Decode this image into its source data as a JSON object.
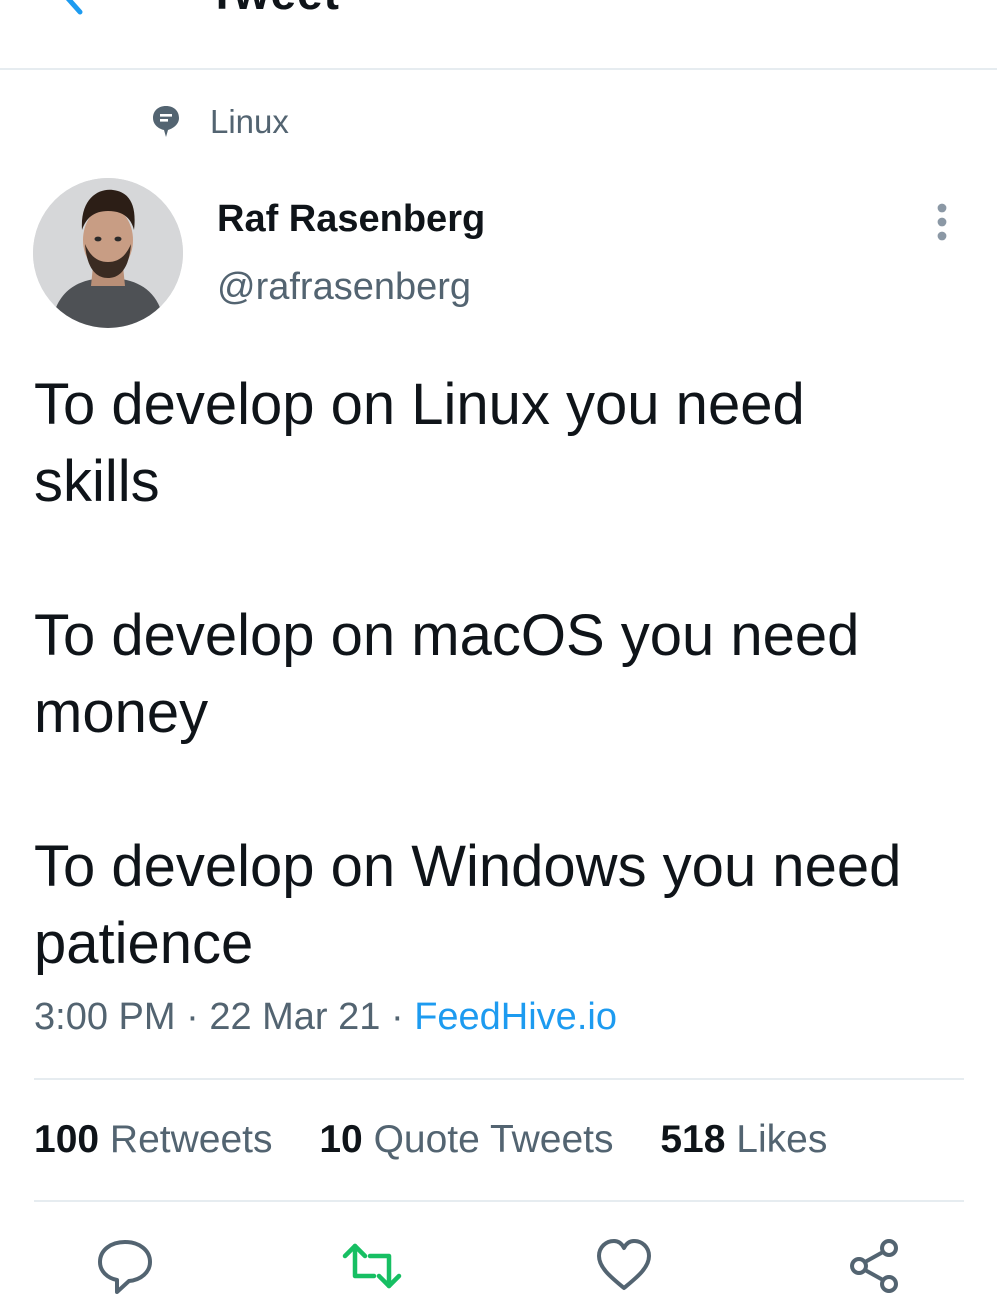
{
  "header": {
    "title": "Tweet"
  },
  "topic": {
    "label": "Linux"
  },
  "author": {
    "name": "Raf Rasenberg",
    "handle": "@rafrasenberg"
  },
  "tweet": {
    "paragraphs": [
      {
        "line1": "To develop on Linux you need",
        "line2": "skills"
      },
      {
        "line1": "To develop on macOS you need",
        "line2": "money"
      },
      {
        "line1": "To develop on Windows you need",
        "line2": "patience"
      }
    ],
    "time": "3:00 PM",
    "separator": "·",
    "date": "22 Mar 21",
    "source": "FeedHive.io"
  },
  "stats": {
    "retweets": {
      "count": "100",
      "label": "Retweets"
    },
    "quotes": {
      "count": "10",
      "label": "Quote Tweets"
    },
    "likes": {
      "count": "518",
      "label": "Likes"
    }
  },
  "icons": {
    "back": "arrow-left-icon",
    "topic": "topic-bubble-icon",
    "more": "more-vertical-icon",
    "reply": "reply-icon",
    "retweet": "retweet-icon",
    "like": "heart-icon",
    "share": "share-icon"
  },
  "colors": {
    "accent": "#1d9bf0",
    "retweet_green": "#17bf63",
    "secondary_text": "#536471",
    "primary_text": "#0f1419",
    "divider": "#e6ecf0"
  }
}
